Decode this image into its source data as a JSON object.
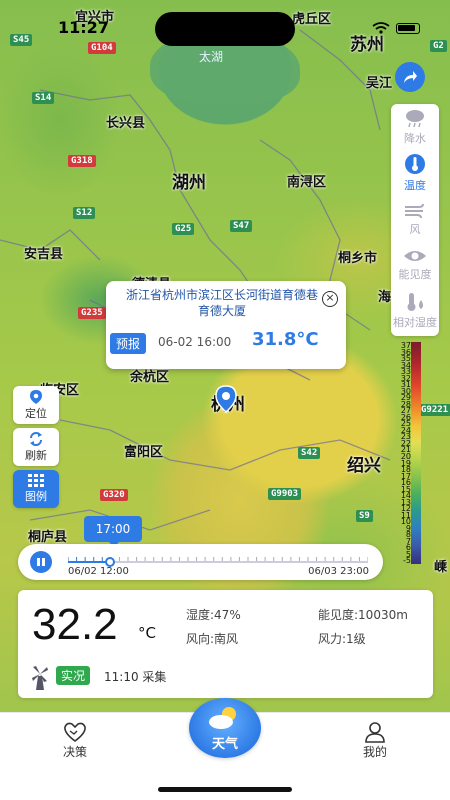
{
  "status_bar": {
    "time": "11:27"
  },
  "map": {
    "places": [
      {
        "name": "宜兴市",
        "big": false
      },
      {
        "name": "虎丘区",
        "big": false
      },
      {
        "name": "苏州",
        "big": true
      },
      {
        "name": "吴江",
        "big": false
      },
      {
        "name": "长兴县",
        "big": false
      },
      {
        "name": "湖州",
        "big": true
      },
      {
        "name": "南浔区",
        "big": false
      },
      {
        "name": "安吉县",
        "big": false
      },
      {
        "name": "桐乡市",
        "big": false
      },
      {
        "name": "德清县",
        "big": false
      },
      {
        "name": "海",
        "big": false
      },
      {
        "name": "余杭区",
        "big": false
      },
      {
        "name": "临安区",
        "big": false
      },
      {
        "name": "杭州",
        "big": true
      },
      {
        "name": "富阳区",
        "big": false
      },
      {
        "name": "绍兴",
        "big": true
      },
      {
        "name": "桐庐县",
        "big": false
      },
      {
        "name": "嵊",
        "big": false
      }
    ],
    "lake": "太湖",
    "roads": [
      {
        "label": "S45",
        "type": "s"
      },
      {
        "label": "G104",
        "type": "g"
      },
      {
        "label": "S14",
        "type": "s"
      },
      {
        "label": "G318",
        "type": "g"
      },
      {
        "label": "S12",
        "type": "s"
      },
      {
        "label": "G25",
        "type": "s"
      },
      {
        "label": "S47",
        "type": "s"
      },
      {
        "label": "G235",
        "type": "g"
      },
      {
        "label": "G320",
        "type": "g"
      },
      {
        "label": "S42",
        "type": "s"
      },
      {
        "label": "G9903",
        "type": "s"
      },
      {
        "label": "S9",
        "type": "s"
      },
      {
        "label": "G9221",
        "type": "s"
      },
      {
        "label": "G2",
        "type": "s"
      }
    ]
  },
  "tools": [
    {
      "label": "降水",
      "icon": "rain-cloud-icon",
      "active": false
    },
    {
      "label": "温度",
      "icon": "thermometer-icon",
      "active": true
    },
    {
      "label": "风",
      "icon": "wind-icon",
      "active": false
    },
    {
      "label": "能见度",
      "icon": "eye-icon",
      "active": false
    },
    {
      "label": "相对湿度",
      "icon": "humidity-icon",
      "active": false
    }
  ],
  "legend": {
    "values": [
      "37",
      "36",
      "35",
      "34",
      "33",
      "32",
      "31",
      "30",
      "29",
      "28",
      "27",
      "26",
      "25",
      "24",
      "23",
      "22",
      "21",
      "20",
      "19",
      "18",
      "17",
      "16",
      "15",
      "14",
      "13",
      "12",
      "11",
      "10",
      "9",
      "8",
      "7",
      "6",
      "5",
      "-5"
    ]
  },
  "left_buttons": {
    "locate": "定位",
    "refresh": "刷新",
    "legend": "图例"
  },
  "popup": {
    "address": "浙江省杭州市滨江区长河街道育德巷育德大厦",
    "tag": "预报",
    "time": "06-02 16:00",
    "temperature": "31.8°C"
  },
  "timeline": {
    "current": "17:00",
    "start": "06/02 12:00",
    "end": "06/03 23:00",
    "progress": 0.14
  },
  "observation": {
    "temperature": "32.2",
    "unit": "°C",
    "humidity": "湿度:47%",
    "visibility": "能见度:10030m",
    "wind_direction": "风向:南风",
    "wind_force": "风力:1级",
    "tag": "实况",
    "collected": "11:10 采集"
  },
  "nav": {
    "left": "决策",
    "center": "天气",
    "right": "我的"
  },
  "colors": {
    "accent": "#2e7be6",
    "obs_green": "#2fa84e"
  }
}
